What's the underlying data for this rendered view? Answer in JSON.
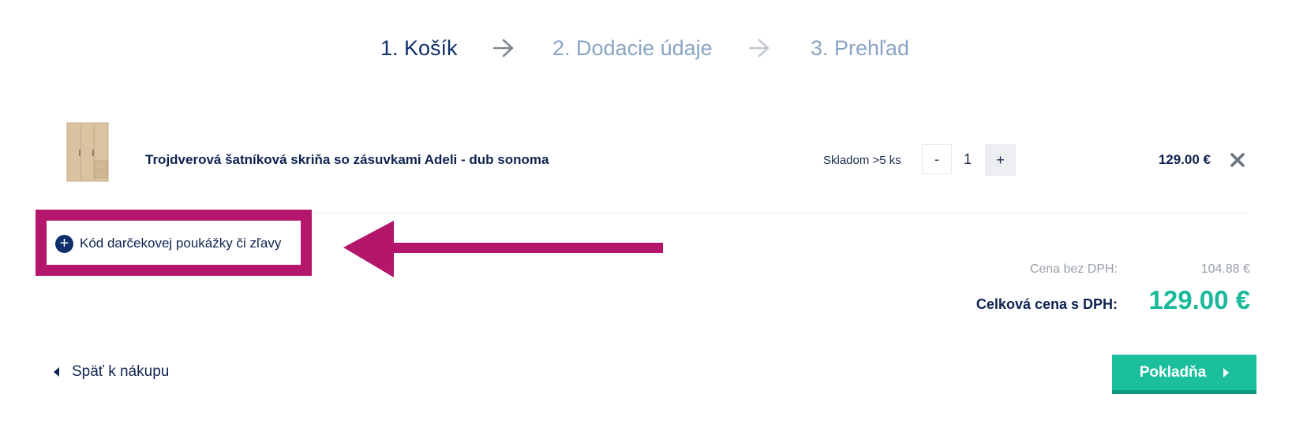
{
  "steps": [
    {
      "label": "1. Košík",
      "state": "active"
    },
    {
      "label": "2. Dodacie údaje",
      "state": "inactive"
    },
    {
      "label": "3. Prehľad",
      "state": "inactive"
    }
  ],
  "cart": {
    "items": [
      {
        "name": "Trojdverová šatníková skriňa so zásuvkami Adeli - dub sonoma",
        "stock": "Skladom >5 ks",
        "quantity": "1",
        "minus_label": "-",
        "plus_label": "+",
        "price": "129.00 €",
        "image_icon": "wardrobe-thumbnail"
      }
    ]
  },
  "coupon": {
    "label": "Kód darčekovej poukážky či zľavy",
    "icon": "plus-circle-icon"
  },
  "totals": {
    "no_vat_label": "Cena bez DPH:",
    "no_vat_value": "104.88 €",
    "total_label": "Celková cena s DPH:",
    "total_value": "129.00 €"
  },
  "actions": {
    "back_label": "Späť k nákupu",
    "checkout_label": "Pokladňa"
  },
  "colors": {
    "primary_navy": "#0f2f6a",
    "inactive_step": "#8aa4c3",
    "accent_green": "#1bbf9c",
    "annotation_magenta": "#b3166a"
  }
}
